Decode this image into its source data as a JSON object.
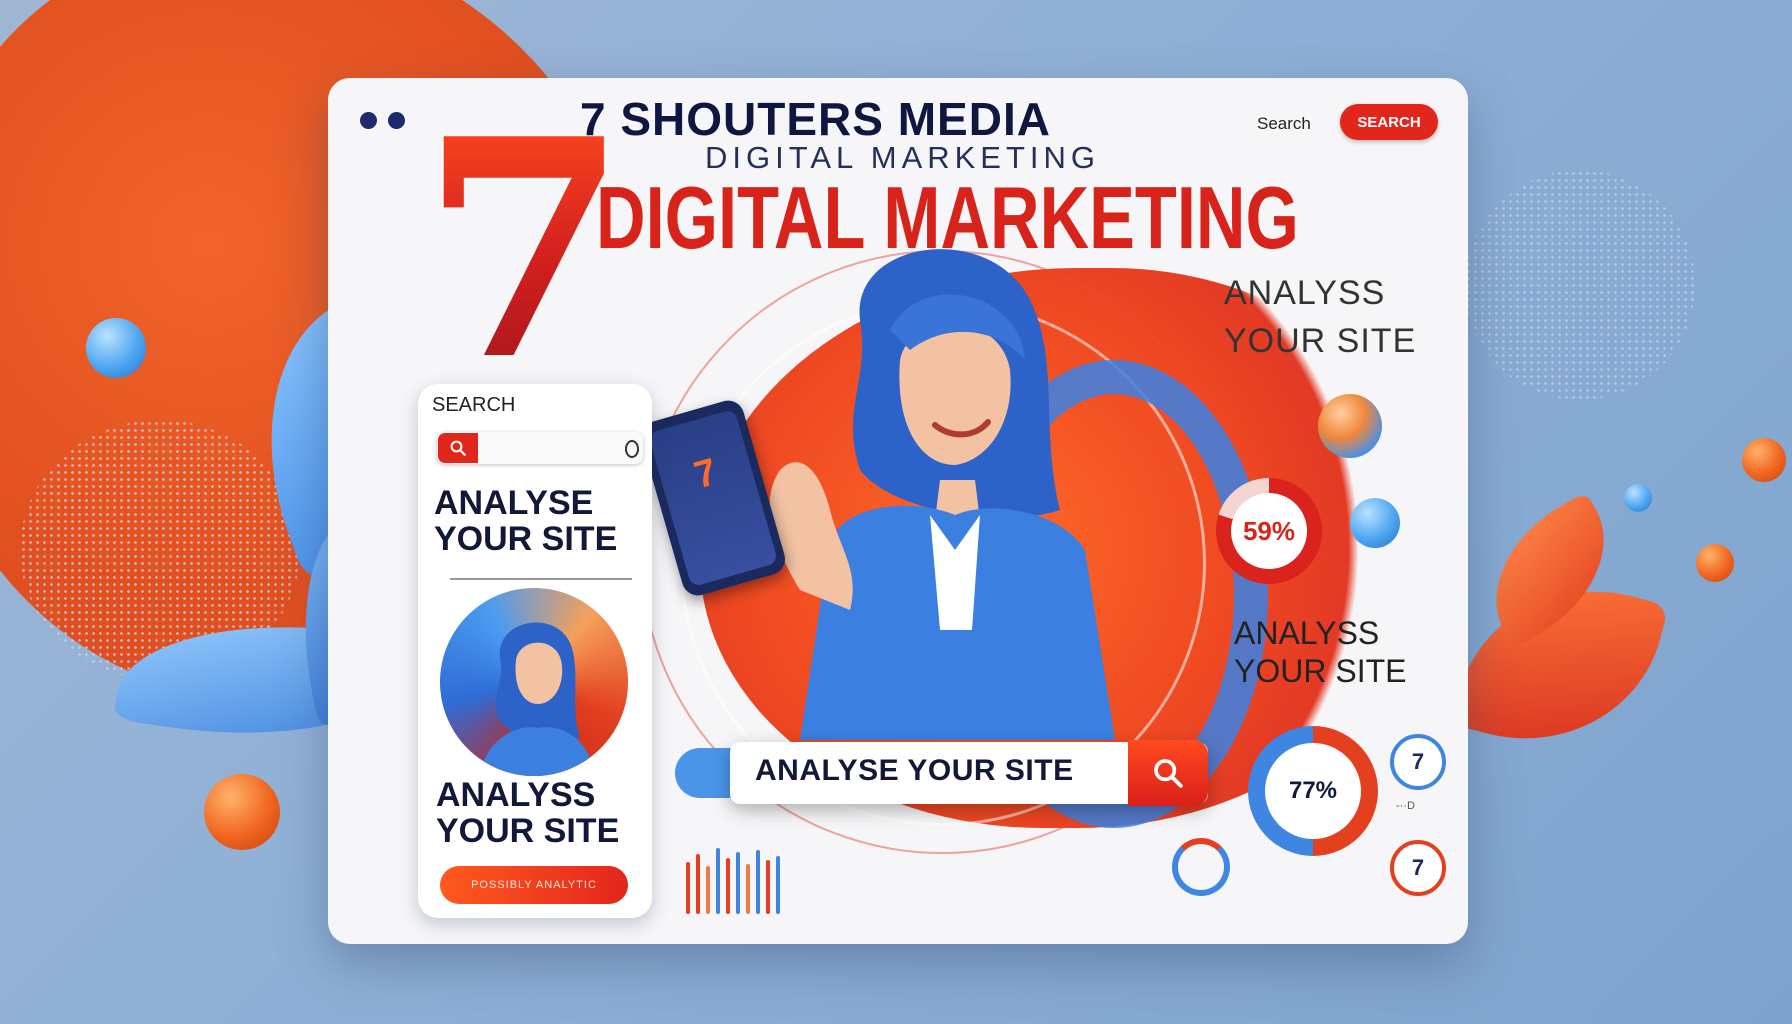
{
  "header": {
    "brand_line": "7 SHOUTERS MEDIA",
    "brand_subline": "DIGITAL MARKETING",
    "big_number": "7",
    "headline": "DIGITAL MARKETING",
    "search_label": "Search",
    "search_button": "SEARCH"
  },
  "right_panel": {
    "analyse_line1": "ANALYSS",
    "analyse_line2": "YOUR SITE",
    "analyse_line3": "ANALYSS",
    "analyse_line4": "YOUR SITE",
    "gauge_top": "59%",
    "gauge_bottom": "77%",
    "small_top": "7",
    "small_bottom": "7",
    "mini_label": "-··D"
  },
  "phone_panel": {
    "search_label": "SEARCH",
    "analyse_line1": "ANALYSE",
    "analyse_line2": "YOUR SITE",
    "analyse_line3": "ANALYSS",
    "analyse_line4": "YOUR SITE",
    "cta_label": "POSSIBLY ANALYTIC"
  },
  "hero": {
    "phone_number": "7",
    "search_text": "ANALYSE YOUR SITE"
  },
  "colors": {
    "accent_red": "#e3261c",
    "accent_orange": "#f0642a",
    "accent_blue": "#3f86e3",
    "navy": "#121838"
  },
  "icons": [
    "search-icon",
    "window-dots"
  ]
}
